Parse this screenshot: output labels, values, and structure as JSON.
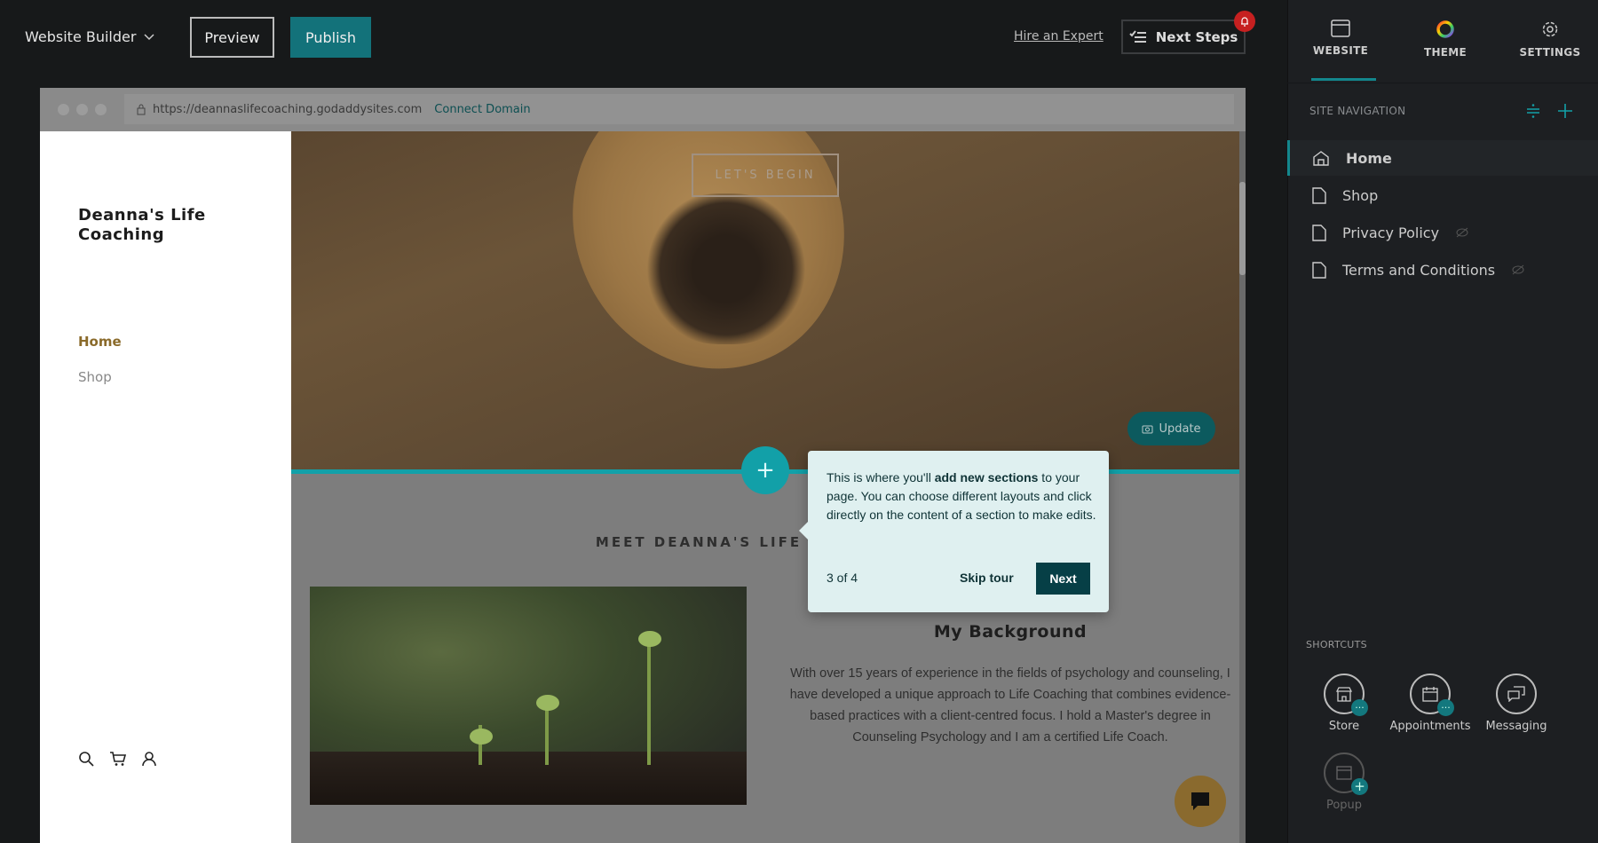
{
  "topbar": {
    "brand": "Website Builder",
    "preview": "Preview",
    "publish": "Publish",
    "hire_expert": "Hire an Expert",
    "next_steps": "Next Steps"
  },
  "browser": {
    "url": "https://deannaslifecoaching.godaddysites.com",
    "connect_domain": "Connect Domain"
  },
  "site": {
    "title": "Deanna's Life Coaching",
    "nav": [
      {
        "label": "Home",
        "active": true
      },
      {
        "label": "Shop"
      }
    ],
    "hero": {
      "cta": "LET'S BEGIN",
      "update": "Update"
    },
    "section_heading": "MEET DEANNA'S LIFE",
    "background_title": "My Background",
    "background_text": "With over 15 years of experience in the fields of psychology and counseling, I have developed a unique approach to Life Coaching that combines evidence-based practices with a client-centred focus. I hold a Master's degree in Counseling Psychology and I am a certified Life Coach."
  },
  "tooltip": {
    "text_before": "This is where you'll ",
    "text_bold": "add new sections",
    "text_after": " to your page. You can choose different layouts and click directly on the content of a section to make edits.",
    "step": "3 of 4",
    "skip": "Skip tour",
    "next": "Next"
  },
  "panel": {
    "tabs": [
      {
        "label": "WEBSITE",
        "icon": "browser-window-icon",
        "active": true
      },
      {
        "label": "THEME",
        "icon": "color-wheel-icon"
      },
      {
        "label": "SETTINGS",
        "icon": "gear-icon"
      }
    ],
    "site_navigation": "SITE NAVIGATION",
    "pages": [
      {
        "label": "Home",
        "icon": "home-icon",
        "active": true
      },
      {
        "label": "Shop",
        "icon": "page-icon"
      },
      {
        "label": "Privacy Policy",
        "icon": "page-icon",
        "hidden": true
      },
      {
        "label": "Terms and Conditions",
        "icon": "page-icon",
        "hidden": true
      }
    ],
    "shortcuts_label": "SHORTCUTS",
    "shortcuts": [
      {
        "label": "Store",
        "icon": "store-icon"
      },
      {
        "label": "Appointments",
        "icon": "calendar-icon"
      },
      {
        "label": "Messaging",
        "icon": "chat-bubbles-icon"
      },
      {
        "label": "Popup",
        "icon": "popup-icon",
        "disabled": true
      }
    ]
  },
  "colors": {
    "accent": "#12a0a8",
    "publish": "#13727a",
    "tour_next": "#063f46",
    "nav_active": "#8a6a2a",
    "notification": "#c62020"
  }
}
